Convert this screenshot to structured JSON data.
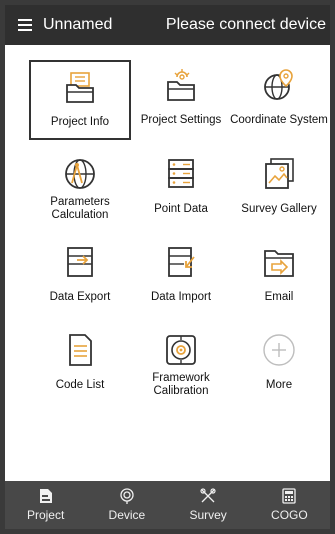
{
  "header": {
    "title": "Unnamed",
    "status": "Please connect device"
  },
  "tiles": [
    {
      "label": "Project Info",
      "icon": "folder-info-icon",
      "selected": true
    },
    {
      "label": "Project Settings",
      "icon": "folder-settings-icon"
    },
    {
      "label": "Coordinate System",
      "icon": "globe-pin-icon"
    },
    {
      "label": "Parameters Calculation",
      "icon": "globe-compass-icon"
    },
    {
      "label": "Point Data",
      "icon": "database-icon"
    },
    {
      "label": "Survey Gallery",
      "icon": "gallery-icon"
    },
    {
      "label": "Data Export",
      "icon": "data-export-icon"
    },
    {
      "label": "Data Import",
      "icon": "data-import-icon"
    },
    {
      "label": "Email",
      "icon": "folder-send-icon"
    },
    {
      "label": "Code List",
      "icon": "document-list-icon"
    },
    {
      "label": "Framework Calibration",
      "icon": "target-icon"
    },
    {
      "label": "More",
      "icon": "plus-circle-icon"
    }
  ],
  "bottom_nav": [
    {
      "label": "Project",
      "icon": "project-icon"
    },
    {
      "label": "Device",
      "icon": "device-icon"
    },
    {
      "label": "Survey",
      "icon": "survey-icon"
    },
    {
      "label": "COGO",
      "icon": "calculator-icon"
    }
  ],
  "colors": {
    "header_bg": "#2f2f2f",
    "nav_bg": "#484848",
    "icon_stroke": "#333333",
    "icon_accent": "#e8a33c"
  }
}
